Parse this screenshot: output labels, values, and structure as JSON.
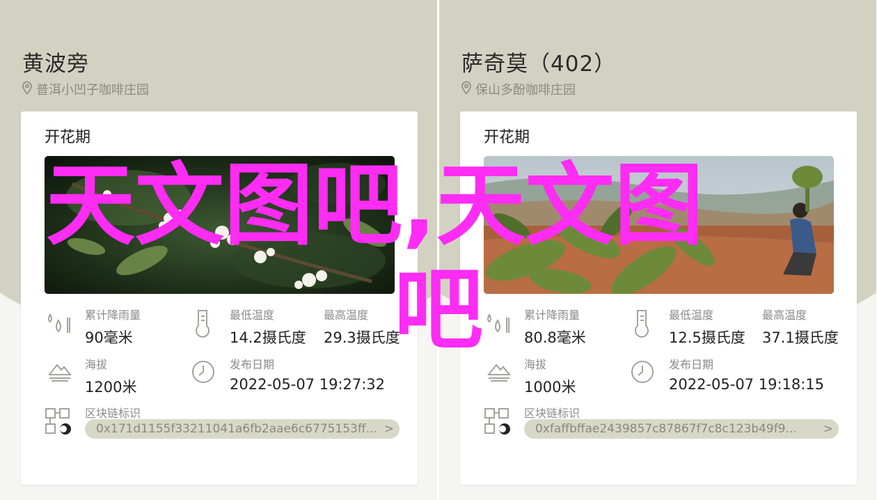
{
  "cards": [
    {
      "title": "黄波旁",
      "location": "普洱小凹子咖啡庄园",
      "section_title": "开花期",
      "stats": {
        "rain_label": "累计降雨量",
        "rain_value": "90毫米",
        "min_temp_label": "最低温度",
        "min_temp_value": "14.2摄氏度",
        "max_temp_label": "最高温度",
        "max_temp_value": "29.3摄氏度",
        "altitude_label": "海拔",
        "altitude_value": "1200米",
        "date_label": "发布日期",
        "date_value": "2022-05-07 19:27:32"
      },
      "chain_label": "区块链标识",
      "chain_hash": "0x171d1155f33211041a6fb2aae6c6775153ff..."
    },
    {
      "title": "萨奇莫（402）",
      "location": "保山多酚咖啡庄园",
      "section_title": "开花期",
      "stats": {
        "rain_label": "累计降雨量",
        "rain_value": "80.8毫米",
        "min_temp_label": "最低温度",
        "min_temp_value": "12.5摄氏度",
        "max_temp_label": "最高温度",
        "max_temp_value": "37.1摄氏度",
        "altitude_label": "海拔",
        "altitude_value": "1000米",
        "date_label": "发布日期",
        "date_value": "2022-05-07 19:18:15"
      },
      "chain_label": "区块链标识",
      "chain_hash": "0xfaffbffae2439857c87867f7c8c123b49f9..."
    }
  ],
  "watermark": {
    "line1": "天文图吧,天文图",
    "line2": "吧",
    "color": "#ff2cf4"
  },
  "icons": {
    "location": "location-pin-icon",
    "rain": "rain-drops-icon",
    "temperature": "thermometer-icon",
    "altitude": "mountain-icon",
    "date": "clock-icon",
    "chain": "blockchain-icon",
    "chevron": "chevron-right-icon"
  },
  "chevron_glyph": ">"
}
